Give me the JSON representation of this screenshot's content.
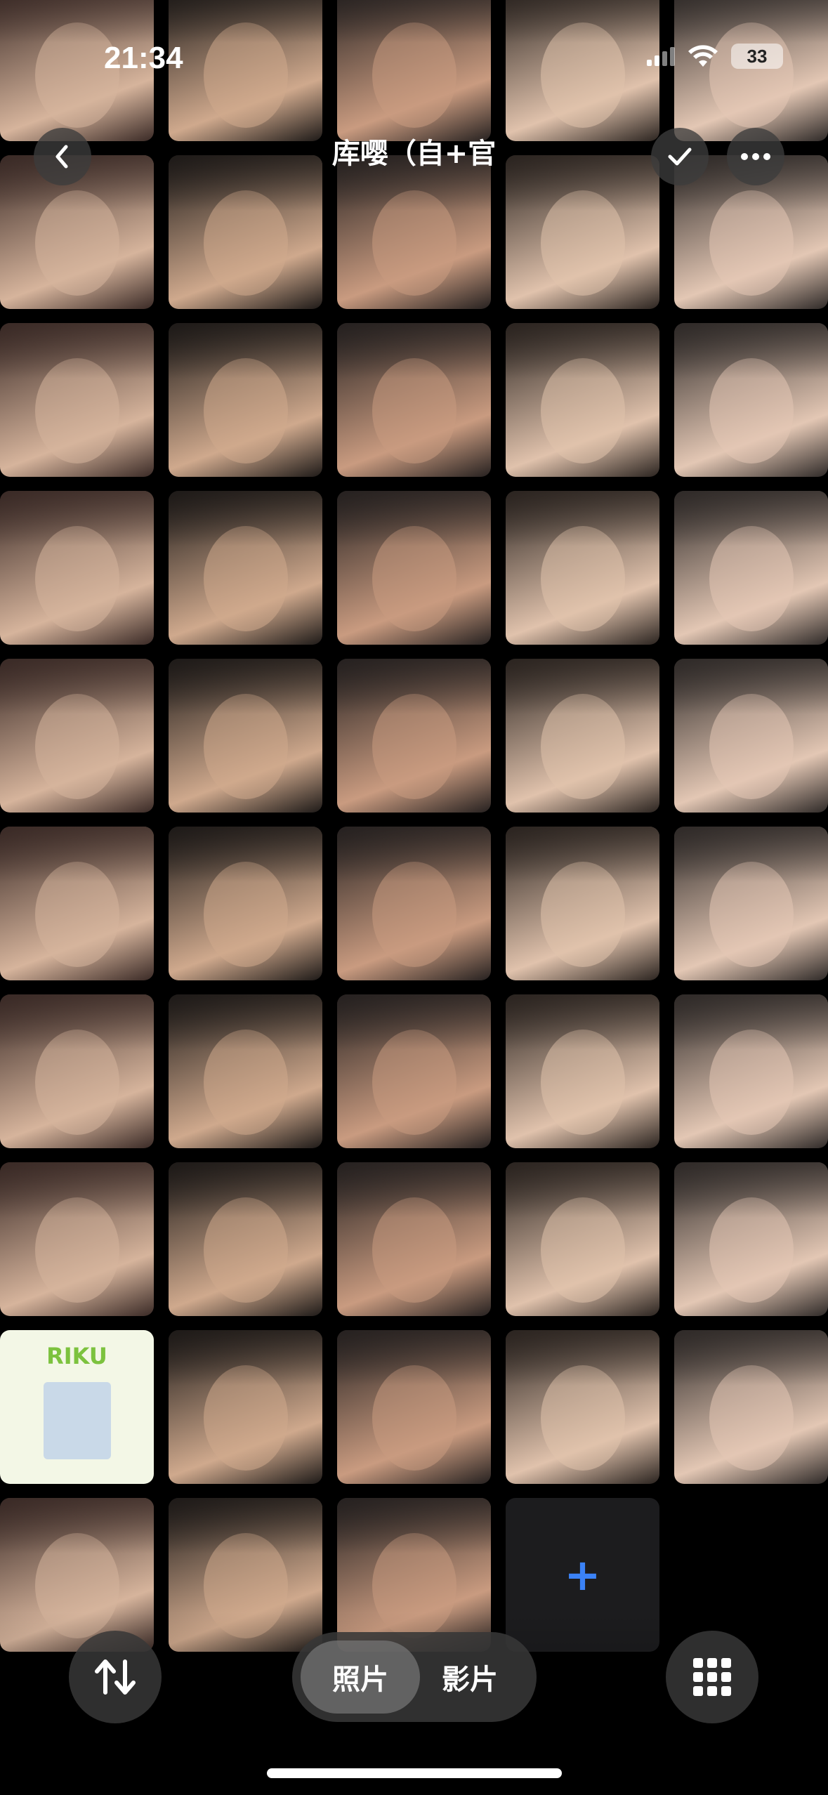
{
  "status_bar": {
    "time": "21:34",
    "battery": "33"
  },
  "nav": {
    "title": "库嘤（自+官",
    "back_icon": "chevron-left-icon",
    "select_icon": "checkmark-icon",
    "more_icon": "ellipsis-icon"
  },
  "grid": {
    "poster_title": "RIKU",
    "add_tile_icon": "plus-icon"
  },
  "bottom_bar": {
    "sort_icon": "sort-arrows-icon",
    "segments": [
      "照片",
      "影片"
    ],
    "selected_segment": "照片",
    "grid_icon": "grid-icon"
  },
  "colors": {
    "accent": "#3b82f6",
    "background": "#000000"
  }
}
